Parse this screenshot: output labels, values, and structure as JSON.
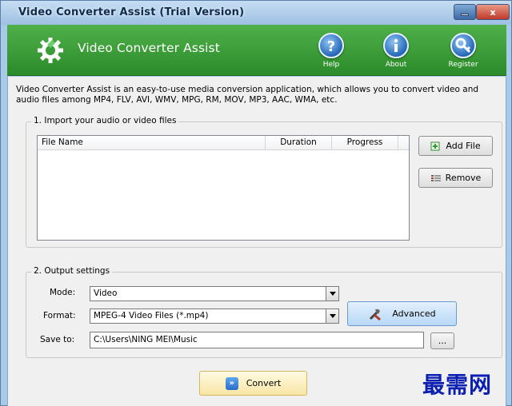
{
  "window": {
    "title": "Video Converter Assist (Trial Version)",
    "minimize_glyph": "",
    "close_glyph": "x"
  },
  "banner": {
    "app_name": "Video Converter Assist",
    "help_label": "Help",
    "about_label": "About",
    "register_label": "Register",
    "icons": {
      "logo": "gear-icon",
      "help": "question-icon",
      "about": "info-icon",
      "register": "key-icon"
    },
    "color": "#3a9e38"
  },
  "description": "Video Converter Assist is an easy-to-use media conversion application, which allows you to convert video and audio files among MP4, FLV, AVI, WMV, MPG, RM, MOV, MP3, AAC, WMA, etc.",
  "import": {
    "legend": "1. Import your audio or video files",
    "columns": [
      "File Name",
      "Duration",
      "Progress"
    ],
    "add_label": "Add File",
    "remove_label": "Remove"
  },
  "output": {
    "legend": "2. Output settings",
    "mode_label": "Mode:",
    "mode_value": "Video",
    "format_label": "Format:",
    "format_value": "MPEG-4 Video Files (*.mp4)",
    "save_label": "Save to:",
    "save_value": "C:\\Users\\NING MEI\\Music",
    "browse_label": "...",
    "advanced_label": "Advanced"
  },
  "convert_label": "Convert",
  "watermark": "最需网"
}
